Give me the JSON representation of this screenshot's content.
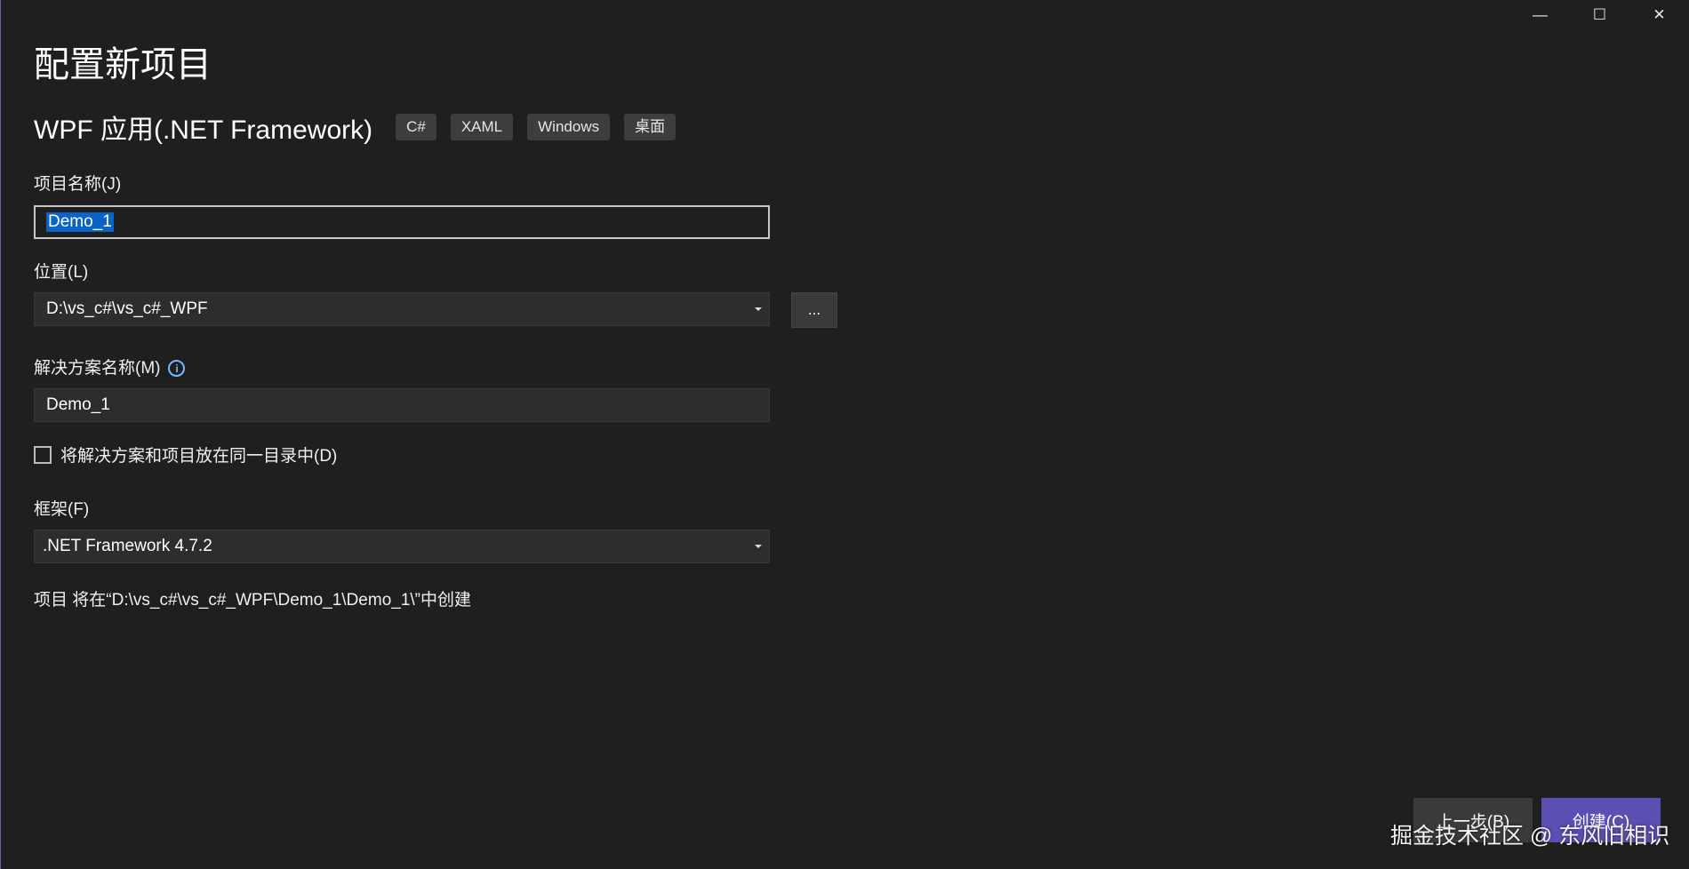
{
  "window": {
    "controls": {
      "minimize": "—",
      "maximize": "☐",
      "close": "✕"
    }
  },
  "page": {
    "title": "配置新项目"
  },
  "template": {
    "name": "WPF 应用(.NET Framework)",
    "tags": [
      "C#",
      "XAML",
      "Windows",
      "桌面"
    ]
  },
  "project_name": {
    "label": "项目名称(J)",
    "value": "Demo_1"
  },
  "location": {
    "label": "位置(L)",
    "value": "D:\\vs_c#\\vs_c#_WPF",
    "browse_label": "..."
  },
  "solution_name": {
    "label": "解决方案名称(M)",
    "info_icon": "i",
    "value": "Demo_1"
  },
  "same_directory": {
    "label": "将解决方案和项目放在同一目录中(D)",
    "checked": false
  },
  "framework": {
    "label": "框架(F)",
    "value": ".NET Framework 4.7.2"
  },
  "summary": {
    "text": "项目 将在“D:\\vs_c#\\vs_c#_WPF\\Demo_1\\Demo_1\\”中创建"
  },
  "footer": {
    "back_label": "上一步(B)",
    "create_label": "创建(C)"
  },
  "watermark": {
    "text": "掘金技术社区 @ 东风旧相识"
  },
  "colors": {
    "background": "#1f1f1f",
    "accent": "#5b4fb3",
    "selection": "#0a64c8",
    "info": "#75b8ff"
  }
}
